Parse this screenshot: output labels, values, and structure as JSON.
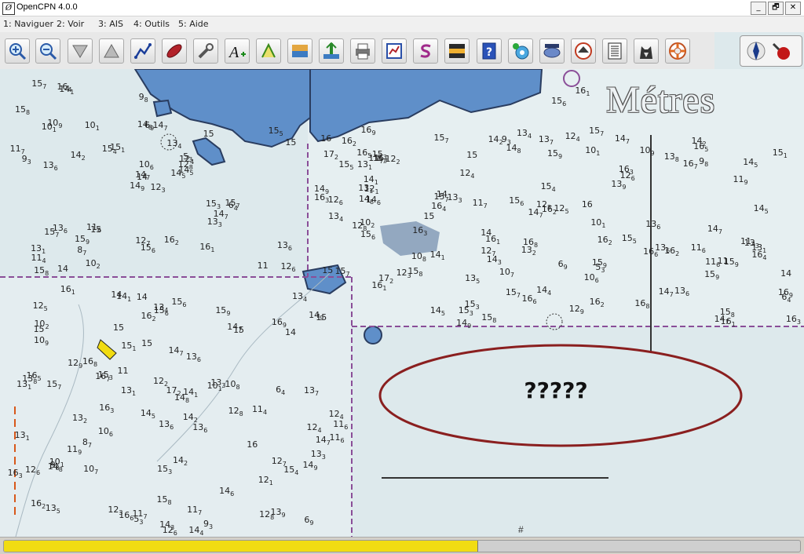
{
  "window": {
    "title": "OpenCPN 4.0.0",
    "app_icon_glyph": "Ø",
    "minimize_glyph": "_",
    "maximize_glyph": "🗗",
    "close_glyph": "✕"
  },
  "menu": [
    "1: Naviguer",
    "2: Voir",
    "3: AIS",
    "4: Outils",
    "5: Aide"
  ],
  "toolbar": {
    "buttons": [
      "zoom-in-icon",
      "zoom-out-icon",
      "scale-down-icon",
      "scale-up-icon",
      "route-icon",
      "mob-icon",
      "settings-wrench-icon",
      "text-annotation-icon",
      "track-icon",
      "chart-icon-1",
      "chart-icon-2",
      "print-icon",
      "route-manager-icon",
      "route-s-icon",
      "sunset-icon",
      "help-book-icon",
      "ais-target-icon",
      "gps-status-icon",
      "tide-boat-icon",
      "text-list-icon",
      "dog-head-icon",
      "lifebuoy-icon"
    ]
  },
  "chart": {
    "overlay_label": "Métres",
    "annotation_text": "?????",
    "hash_label": "#",
    "colors": {
      "shallow": "#dbe7eb",
      "deep": "#e7f0f2",
      "land": "#5f8fc9",
      "coast": "#2a3d60",
      "boundary": "#8a4e98",
      "ellipse": "#8a1f1f"
    },
    "soundings": [
      {
        "t": "12",
        "s": "3"
      },
      {
        "t": "10",
        "s": "1"
      },
      {
        "t": "14",
        "s": ""
      },
      {
        "t": "13",
        "s": "1"
      },
      {
        "t": "12",
        "s": "4"
      },
      {
        "t": "15",
        "s": ""
      },
      {
        "t": "14",
        "s": "7"
      },
      {
        "t": "14",
        "s": "5"
      },
      {
        "t": "14",
        "s": "1"
      },
      {
        "t": "12",
        "s": "6"
      },
      {
        "t": "13",
        "s": "6"
      },
      {
        "t": "14",
        "s": "9"
      },
      {
        "t": "15",
        "s": ""
      },
      {
        "t": "14",
        "s": ""
      },
      {
        "t": "14",
        "s": "8"
      },
      {
        "t": "13",
        "s": "4"
      },
      {
        "t": "13",
        "s": "6"
      },
      {
        "t": "15",
        "s": "1"
      },
      {
        "t": "11",
        "s": "4"
      },
      {
        "t": "8",
        "s": "7"
      },
      {
        "t": "6",
        "s": "9"
      },
      {
        "t": "5",
        "s": "3"
      },
      {
        "t": "6",
        "s": "4"
      },
      {
        "t": "10",
        "s": "9"
      },
      {
        "t": "9",
        "s": "8"
      },
      {
        "t": "9",
        "s": "3"
      },
      {
        "t": "15",
        "s": "3"
      },
      {
        "t": "15",
        "s": ""
      },
      {
        "t": "14",
        "s": "7"
      },
      {
        "t": "12",
        "s": "7"
      },
      {
        "t": "10",
        "s": "6"
      },
      {
        "t": "10",
        "s": "1"
      },
      {
        "t": "11",
        "s": "6"
      },
      {
        "t": "11",
        "s": ""
      },
      {
        "t": "13",
        "s": "6"
      },
      {
        "t": "15",
        "s": "7"
      },
      {
        "t": "15",
        "s": "4"
      },
      {
        "t": "14",
        "s": "2"
      },
      {
        "t": "13",
        "s": "3"
      },
      {
        "t": "10",
        "s": "2"
      },
      {
        "t": "11",
        "s": "7"
      },
      {
        "t": "12",
        "s": "8"
      },
      {
        "t": "15",
        "s": "8"
      },
      {
        "t": "15",
        "s": "6"
      },
      {
        "t": "14",
        "s": "5"
      },
      {
        "t": "15",
        "s": "7"
      },
      {
        "t": "15",
        "s": "5"
      },
      {
        "t": "15",
        "s": "8"
      },
      {
        "t": "14",
        "s": "7"
      },
      {
        "t": "16",
        "s": "1"
      },
      {
        "t": "15",
        "s": "9"
      },
      {
        "t": "16",
        "s": "4"
      },
      {
        "t": "15",
        "s": "7"
      },
      {
        "t": "16",
        "s": "2"
      },
      {
        "t": "15",
        "s": "6"
      },
      {
        "t": "16",
        "s": "3"
      },
      {
        "t": "16",
        "s": "5"
      },
      {
        "t": "16",
        "s": "8"
      },
      {
        "t": "16",
        "s": "9"
      },
      {
        "t": "16",
        "s": "1"
      },
      {
        "t": "15",
        "s": "9"
      },
      {
        "t": "16",
        "s": "2"
      },
      {
        "t": "17",
        "s": "2"
      },
      {
        "t": "16",
        "s": "3"
      },
      {
        "t": "15",
        "s": "3"
      },
      {
        "t": "16",
        "s": "6"
      },
      {
        "t": "16",
        "s": ""
      },
      {
        "t": "16",
        "s": "7"
      },
      {
        "t": "16",
        "s": "2"
      },
      {
        "t": "12",
        "s": "5"
      },
      {
        "t": "12",
        "s": "9"
      },
      {
        "t": "13",
        "s": "1"
      },
      {
        "t": "12",
        "s": "2"
      },
      {
        "t": "11",
        "s": "7"
      },
      {
        "t": "14",
        "s": "1"
      },
      {
        "t": "13",
        "s": "5"
      },
      {
        "t": "12",
        "s": "8"
      },
      {
        "t": "13",
        "s": "3"
      },
      {
        "t": "14",
        "s": "3"
      },
      {
        "t": "13",
        "s": "7"
      },
      {
        "t": "14",
        "s": "2"
      },
      {
        "t": "13",
        "s": "9"
      },
      {
        "t": "14",
        "s": "4"
      },
      {
        "t": "14",
        "s": "6"
      },
      {
        "t": "13",
        "s": "4"
      },
      {
        "t": "11",
        "s": "6"
      },
      {
        "t": "10",
        "s": "8"
      },
      {
        "t": "12",
        "s": "1"
      },
      {
        "t": "14",
        "s": "8"
      },
      {
        "t": "14",
        "s": "9"
      },
      {
        "t": "13",
        "s": "8"
      },
      {
        "t": "12",
        "s": "6"
      },
      {
        "t": "14",
        "s": "7"
      },
      {
        "t": "15",
        "s": ""
      },
      {
        "t": "13",
        "s": "2"
      },
      {
        "t": "14",
        "s": ""
      },
      {
        "t": "12",
        "s": "4"
      },
      {
        "t": "13",
        "s": "1"
      },
      {
        "t": "11",
        "s": "9"
      },
      {
        "t": "10",
        "s": "7"
      }
    ]
  },
  "status": {
    "progress": 0.595
  }
}
